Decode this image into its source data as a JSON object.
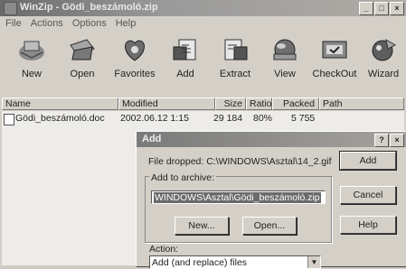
{
  "window": {
    "title": "WinZip - Gödi_beszámoló.zip",
    "controls": [
      "_",
      "□",
      "×"
    ]
  },
  "menu": [
    "File",
    "Actions",
    "Options",
    "Help"
  ],
  "toolbar": [
    {
      "label": "New",
      "icon": "new-archive-icon"
    },
    {
      "label": "Open",
      "icon": "open-archive-icon"
    },
    {
      "label": "Favorites",
      "icon": "favorites-icon"
    },
    {
      "label": "Add",
      "icon": "add-icon"
    },
    {
      "label": "Extract",
      "icon": "extract-icon"
    },
    {
      "label": "View",
      "icon": "view-icon"
    },
    {
      "label": "CheckOut",
      "icon": "checkout-icon"
    },
    {
      "label": "Wizard",
      "icon": "wizard-icon"
    }
  ],
  "columns": [
    "Name",
    "Modified",
    "Size",
    "Ratio",
    "Packed",
    "Path"
  ],
  "rows": [
    {
      "name": "Gödi_beszámoló.doc",
      "modified": "2002.06.12 1:15",
      "size": "29 184",
      "ratio": "80%",
      "packed": "5 755",
      "path": ""
    }
  ],
  "dialog": {
    "title": "Add",
    "title_buttons": [
      "?",
      "×"
    ],
    "file_dropped": "File dropped: C:\\WINDOWS\\Asztal\\14_2.gif",
    "add_to_archive_label": "Add to archive:",
    "archive_path": "WINDOWS\\Asztal\\Gödi_beszámoló.zip",
    "buttons": {
      "add": "Add",
      "cancel": "Cancel",
      "help": "Help",
      "new": "New...",
      "open": "Open..."
    },
    "action_label": "Action:",
    "action_value": "Add (and replace) files"
  },
  "colors": {
    "titlebar": "#7a7a7a",
    "face": "#d4d0c8",
    "selection": "#6a6a6a"
  }
}
